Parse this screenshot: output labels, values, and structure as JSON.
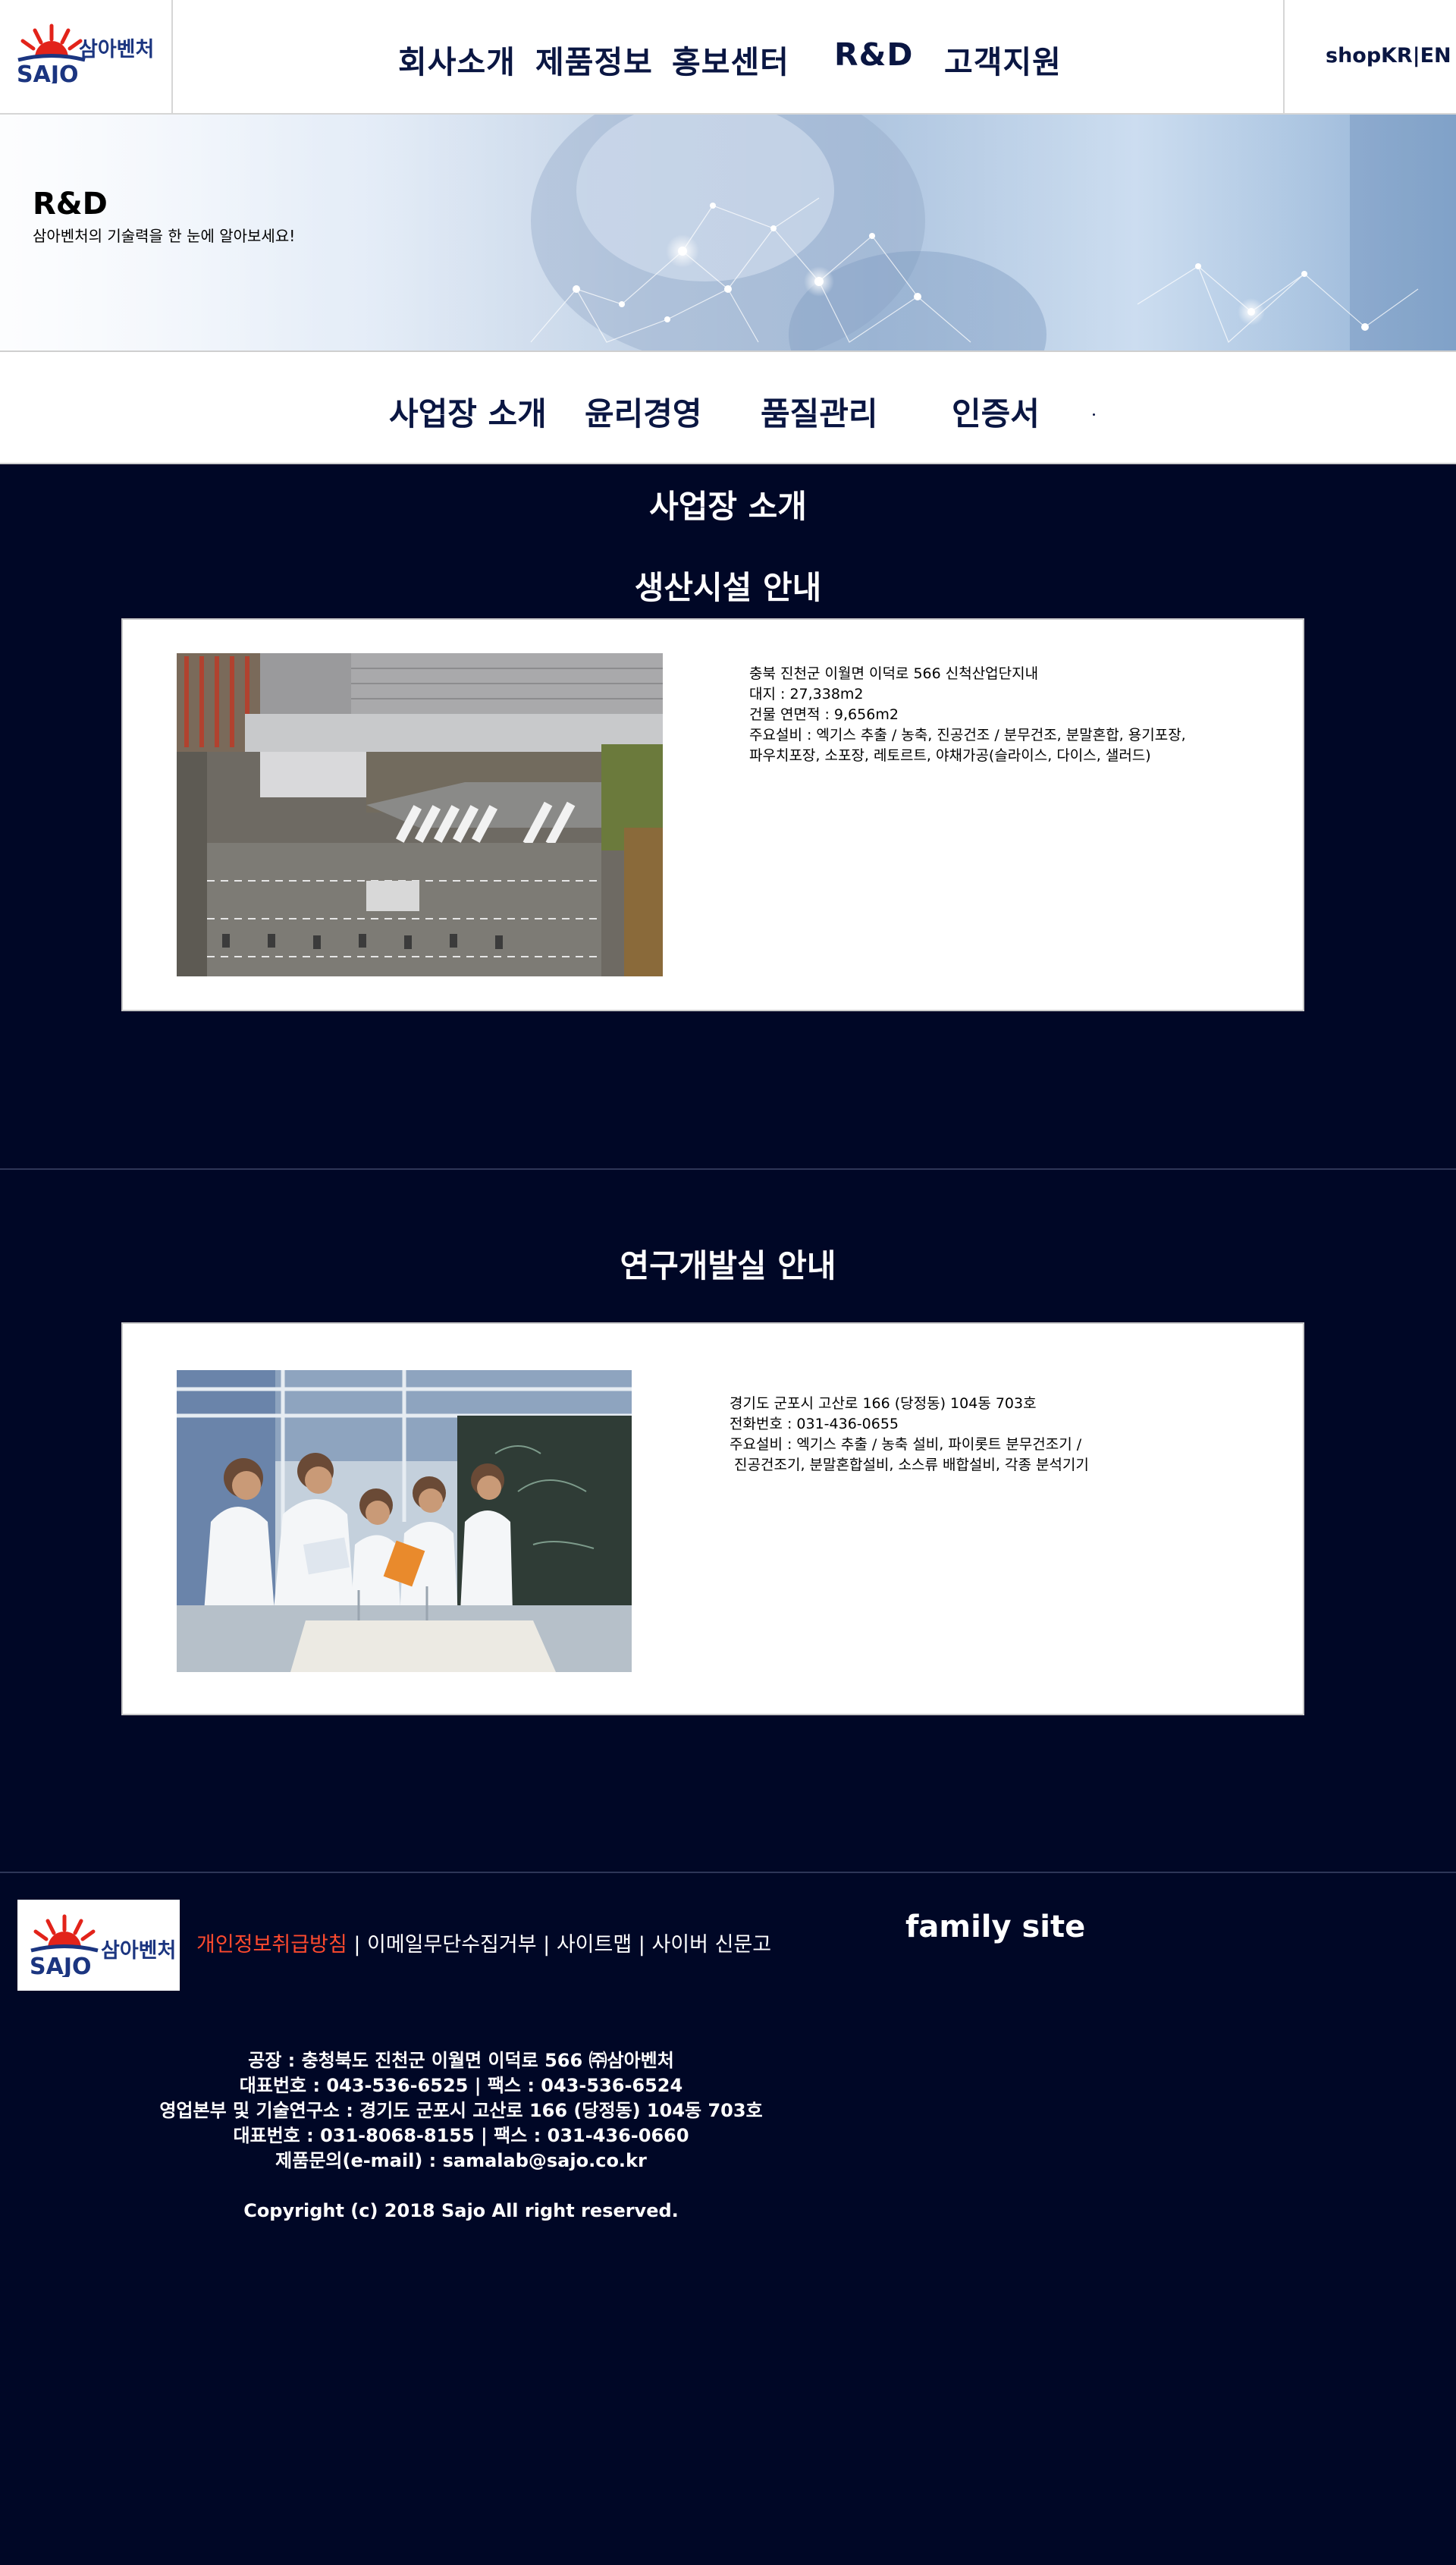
{
  "header": {
    "logo_en": "SAJO",
    "logo_ko": "삼아벤처",
    "nav": [
      "회사소개",
      "제품정보",
      "홍보센터",
      "R&D",
      "고객지원"
    ],
    "shop": "shop",
    "lang": "KR|EN"
  },
  "banner": {
    "title": "R&D",
    "subtitle": "삼아벤처의 기술력을 한 눈에 알아보세요!"
  },
  "subnav": [
    "사업장 소개",
    "윤리경영",
    "품질관리",
    "인증서"
  ],
  "main": {
    "page_title": "사업장 소개",
    "facility": {
      "heading": "생산시설 안내",
      "lines": [
        "충북 진천군 이월면 이덕로 566 신척산업단지내",
        "대지 : 27,338m2",
        "건물 연면적 : 9,656m2",
        "주요설비 : 엑기스 추출 / 농축, 진공건조 / 분무건조, 분말혼합, 용기포장,",
        "파우치포장, 소포장, 레토르트, 야채가공(슬라이스, 다이스, 샐러드)"
      ]
    },
    "lab": {
      "heading": "연구개발실 안내",
      "lines": [
        "경기도 군포시 고산로 166 (당정동) 104동 703호",
        "전화번호 : 031-436-0655",
        "주요설비 : 엑기스 추출 / 농축 설비, 파이롯트 분무건조기 /",
        " 진공건조기, 분말혼합설비, 소스류 배합설비, 각종 분석기기"
      ]
    }
  },
  "footer": {
    "logo_en": "SAJO",
    "logo_ko": "삼아벤처",
    "links": [
      "개인정보취급방침",
      "이메일무단수집거부",
      "사이트맵",
      "사이버 신문고"
    ],
    "separator": " | ",
    "family_site": "family site",
    "info_lines": [
      "공장 : 충청북도 진천군 이월면 이덕로 566 ㈜삼아벤처",
      "대표번호 : 043-536-6525 | 팩스 : 043-536-6524",
      "영업본부 및 기술연구소 : 경기도 군포시 고산로 166 (당정동) 104동 703호",
      "대표번호 : 031-8068-8155 | 팩스 : 031-436-0660",
      "제품문의(e-mail) : samalab@sajo.co.kr"
    ],
    "copyright": "Copyright (c) 2018 Sajo All right reserved."
  },
  "colors": {
    "background": "#000726",
    "brand_navy": "#1b3580",
    "brand_red": "#e2231a",
    "link_highlight": "#ff4a2e"
  }
}
